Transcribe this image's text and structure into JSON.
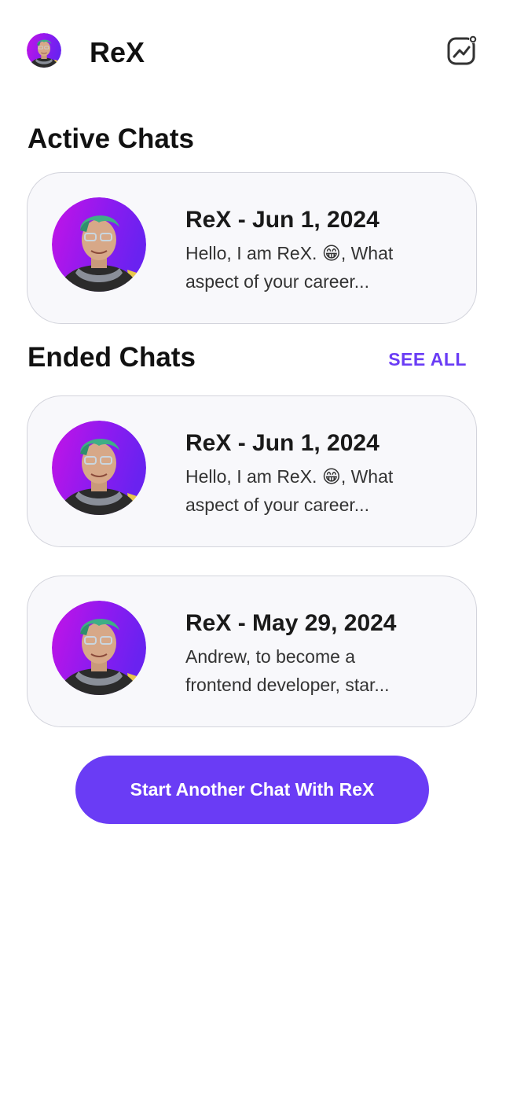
{
  "header": {
    "title": "ReX",
    "avatar_icon": "rex-avatar-icon",
    "action_icon": "insights-chart-icon"
  },
  "active": {
    "title": "Active Chats",
    "chats": [
      {
        "title": "ReX - Jun 1, 2024",
        "preview_line1": "Hello, I am ReX. 😁, What",
        "preview_line2": "aspect of your career..."
      }
    ]
  },
  "ended": {
    "title": "Ended Chats",
    "see_all_label": "SEE ALL",
    "chats": [
      {
        "title": "ReX - Jun 1, 2024",
        "preview_line1": "Hello, I am ReX. 😁, What",
        "preview_line2": "aspect of your career..."
      },
      {
        "title": "ReX - May 29, 2024",
        "preview_line1": "Andrew, to become a",
        "preview_line2": "frontend developer, star..."
      }
    ]
  },
  "start_button_label": "Start Another Chat With ReX",
  "colors": {
    "accent": "#6a3cf5",
    "card_bg": "#f8f8fb",
    "card_border": "#d3d4dc"
  }
}
